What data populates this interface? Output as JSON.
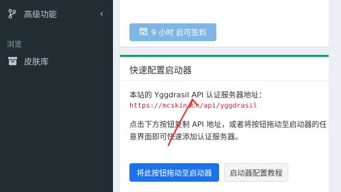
{
  "sidebar": {
    "advanced": {
      "label": "高级功能",
      "icon": "branch-icon"
    },
    "section_browse": "浏览",
    "skin_library": {
      "label": "皮肤库",
      "icon": "archive-icon"
    }
  },
  "sign_card": {
    "button_label": "9 小时 后可签到",
    "icon": "calendar-check-icon"
  },
  "launcher_card": {
    "title": "快速配置启动器",
    "api_text": "本站的 Yggdrasil API 认证服务器地址：",
    "api_url": "https://mcskin.cn/api/yggdrasil",
    "instructions": "点击下方按钮复制 API 地址，或者将按钮拖动至启动器的任意界面即可快速添加认证服务器。",
    "drag_button": "将此按钮拖动至启动器",
    "tutorial_button": "启动器配置教程",
    "accent_color": "#00a65a"
  }
}
